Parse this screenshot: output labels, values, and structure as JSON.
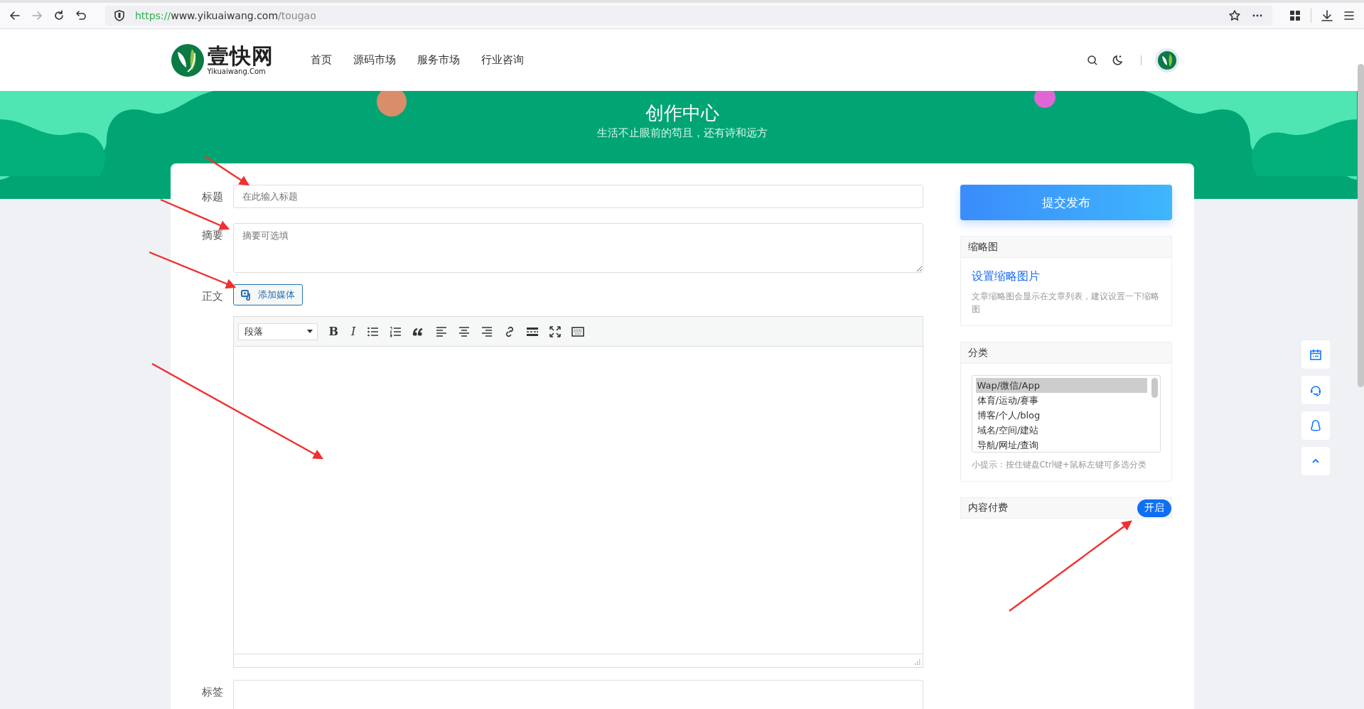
{
  "browser": {
    "url": "https://www.yikuaiwang.com/tougao"
  },
  "header": {
    "logo_text": "壹快网",
    "logo_subtext": "Yikuaiwang.Com",
    "nav": [
      {
        "label": "首页"
      },
      {
        "label": "源码市场"
      },
      {
        "label": "服务市场"
      },
      {
        "label": "行业咨询"
      }
    ]
  },
  "banner": {
    "title": "创作中心",
    "subtitle": "生活不止眼前的苟且，还有诗和远方"
  },
  "form": {
    "title_label": "标题",
    "title_placeholder": "在此输入标题",
    "summary_label": "摘要",
    "summary_placeholder": "摘要可选填",
    "body_label": "正文",
    "add_media": "添加媒体",
    "editor": {
      "format": "段落",
      "tools": [
        {
          "kind": "bold",
          "glyph": "B"
        },
        {
          "kind": "italic",
          "glyph": "I"
        },
        {
          "kind": "bullets"
        },
        {
          "kind": "numbers"
        },
        {
          "kind": "quote"
        },
        {
          "kind": "align-left"
        },
        {
          "kind": "align-center"
        },
        {
          "kind": "align-right"
        },
        {
          "kind": "link"
        },
        {
          "kind": "more"
        },
        {
          "kind": "fullscreen"
        },
        {
          "kind": "keyboard"
        }
      ]
    },
    "tags_label": "标签"
  },
  "sidebar": {
    "submit": "提交发布",
    "thumbnail": {
      "title": "缩略图",
      "link": "设置缩略图片",
      "hint": "文章缩略图会显示在文章列表，建议设置一下缩略图"
    },
    "category": {
      "title": "分类",
      "options": [
        {
          "label": "Wap/微信/App",
          "selected": true
        },
        {
          "label": "体育/运动/赛事",
          "selected": false
        },
        {
          "label": "博客/个人/blog",
          "selected": false
        },
        {
          "label": "域名/空间/建站",
          "selected": false
        },
        {
          "label": "导航/网址/查询",
          "selected": false
        }
      ],
      "hint": "小提示：按住键盘Ctrl键+鼠标左键可多选分类"
    },
    "paid": {
      "title": "内容付费",
      "button": "开启"
    }
  },
  "float_buttons": [
    {
      "kind": "calendar"
    },
    {
      "kind": "headset"
    },
    {
      "kind": "penguin"
    },
    {
      "kind": "top"
    }
  ]
}
